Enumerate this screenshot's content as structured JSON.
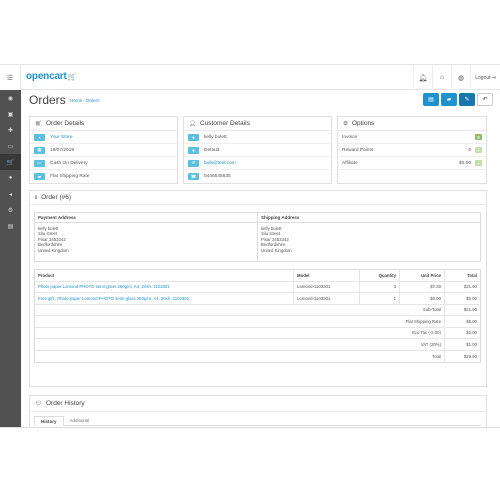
{
  "header": {
    "logo_text": "opencart",
    "logo_cart": "🛒",
    "icons": [
      "bell-icon",
      "home-icon",
      "globe-icon",
      "life-ring-icon"
    ],
    "logout_label": "Logout"
  },
  "sidebar": {
    "toggle_icon": "☰",
    "items": [
      {
        "name": "dashboard",
        "glyph": "◉"
      },
      {
        "name": "catalog",
        "glyph": "▣"
      },
      {
        "name": "extensions",
        "glyph": "✚"
      },
      {
        "name": "design",
        "glyph": "▭"
      },
      {
        "name": "sales",
        "glyph": "🛒",
        "active": true
      },
      {
        "name": "customers",
        "glyph": "●"
      },
      {
        "name": "marketing",
        "glyph": "◂"
      },
      {
        "name": "system",
        "glyph": "⚙"
      },
      {
        "name": "reports",
        "glyph": "▤"
      }
    ]
  },
  "page": {
    "title": "Orders",
    "breadcrumb_home": "Home",
    "breadcrumb_sep": "/",
    "breadcrumb_current": "Orders"
  },
  "order_details": {
    "title": "Order Details",
    "store": "Your Store",
    "date": "19/07/2019",
    "payment": "Cash On Delivery",
    "shipping": "Flat Shipping Rate"
  },
  "customer_details": {
    "title": "Customer Details",
    "name": "kelly bulett",
    "group": "Default",
    "email": "bulk@test.com",
    "phone": "0446545635"
  },
  "options": {
    "title": "Options",
    "rows": [
      {
        "label": "Invoice",
        "value": "",
        "button": "gear",
        "pale": false
      },
      {
        "label": "Reward Points",
        "value": "0",
        "button": "plus",
        "pale": true
      },
      {
        "label": "Affiliate",
        "value": "$0.00",
        "button": "plus",
        "pale": true
      }
    ]
  },
  "order": {
    "title": "Order (#6)",
    "payment_address_label": "Payment Address",
    "shipping_address_label": "Shipping Address",
    "payment_address": "kelly bulett\nSilu street\nPisar 3453342\nBedfordshire\nUnited Kingdom",
    "shipping_address": "kelly bulett\nSilu street\nPisar 3453342\nBedfordshire\nUnited Kingdom",
    "columns": [
      "Product",
      "Model",
      "Quantity",
      "Unit Price",
      "Total"
    ],
    "products": [
      {
        "name": "Photo paper Lomond PHOTO semi-gloss 260g/m, A4, 20sh. 1103301",
        "model": "Lomond-1103301",
        "qty": "3",
        "unit": "$7.30",
        "total": "$21.90"
      },
      {
        "name": "Free gift : Photo paper Lomond PHOTO semi-gloss 260g/m, A4, 20sh. 1103301",
        "model": "Lomond-1103301",
        "qty": "1",
        "unit": "$0.00",
        "total": "$0.00"
      }
    ],
    "totals": [
      {
        "label": "Sub-Total",
        "value": "$21.90"
      },
      {
        "label": "Flat Shipping Rate",
        "value": "$5.00"
      },
      {
        "label": "Eco Tax (-2.00)",
        "value": "$2.00"
      },
      {
        "label": "VAT (20%)",
        "value": "$1.00"
      },
      {
        "label": "Total",
        "value": "$29.90"
      }
    ]
  },
  "history": {
    "title": "Order History",
    "tabs": [
      "History",
      "Additional"
    ]
  },
  "colors": {
    "brand_blue": "#1e91cf",
    "info_blue": "#5bc0de",
    "success_green": "#8fbb6c",
    "sidebar_bg": "#515151"
  }
}
